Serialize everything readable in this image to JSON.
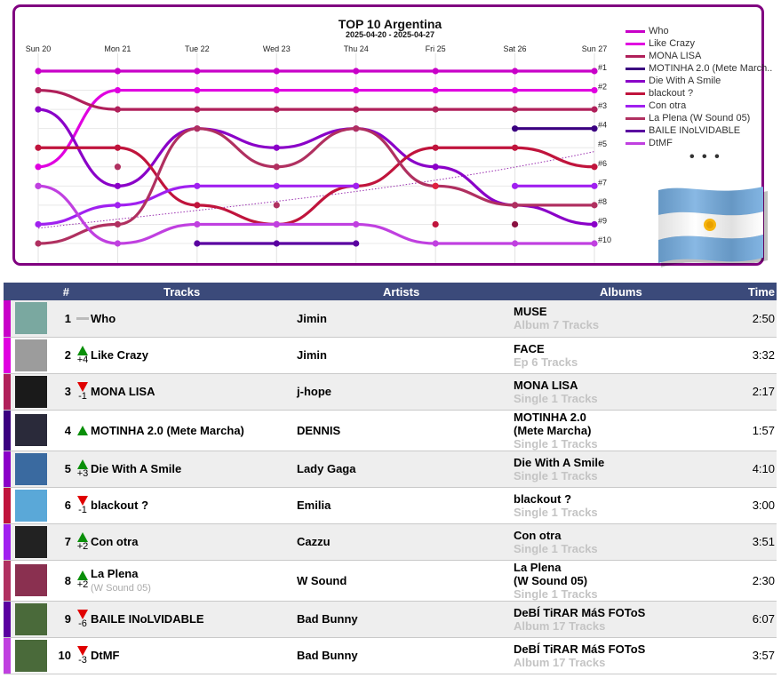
{
  "chart_data": {
    "type": "line",
    "title": "TOP 10 Argentina",
    "subtitle": "2025-04-20 - 2025-04-27",
    "x": [
      "Sun 20",
      "Mon 21",
      "Tue 22",
      "Wed 23",
      "Thu 24",
      "Fri 25",
      "Sat 26",
      "Sun 27"
    ],
    "y_reversed": true,
    "ylim": [
      1,
      10
    ],
    "right_labels": [
      "#1",
      "#2",
      "#3",
      "#4",
      "#5",
      "#6",
      "#7",
      "#8",
      "#9",
      "#10"
    ],
    "grid": true,
    "legend_position": "right",
    "series": [
      {
        "name": "Who",
        "color": "#c800c8",
        "values": [
          1,
          1,
          1,
          1,
          1,
          1,
          1,
          1
        ]
      },
      {
        "name": "Like Crazy",
        "color": "#e000e0",
        "values": [
          6,
          2,
          2,
          2,
          2,
          2,
          2,
          2
        ]
      },
      {
        "name": "MONA LISA",
        "color": "#b0205a",
        "values": [
          2,
          3,
          3,
          3,
          3,
          3,
          3,
          3
        ]
      },
      {
        "name": "MOTINHA 2.0 (Mete March..",
        "color": "#3a0080",
        "values": [
          null,
          null,
          null,
          null,
          null,
          null,
          4,
          4
        ]
      },
      {
        "name": "Die With A Smile",
        "color": "#8a00c8",
        "values": [
          3,
          7,
          4,
          5,
          4,
          6,
          8,
          9
        ]
      },
      {
        "name": "blackout ?",
        "color": "#c0143c",
        "values": [
          5,
          5,
          8,
          9,
          7,
          5,
          5,
          6
        ]
      },
      {
        "name": "Con otra",
        "color": "#a020f0",
        "values": [
          9,
          8,
          7,
          7,
          7,
          null,
          7,
          7
        ]
      },
      {
        "name": "La Plena (W Sound 05)",
        "color": "#b03060",
        "values": [
          10,
          9,
          4,
          6,
          4,
          7,
          8,
          8
        ]
      },
      {
        "name": "BAILE INoLVIDABLE",
        "color": "#5a00a0",
        "values": [
          null,
          null,
          10,
          10,
          10,
          null,
          null,
          null
        ]
      },
      {
        "name": "DtMF",
        "color": "#c040e0",
        "values": [
          7,
          10,
          9,
          9,
          9,
          10,
          10,
          10
        ]
      }
    ],
    "extra_points": [
      {
        "x": "Sun 20",
        "y": 7
      },
      {
        "x": "Mon 21",
        "y": 6
      },
      {
        "x": "Wed 23",
        "y": 8
      },
      {
        "x": "Fri 25",
        "y": 7
      },
      {
        "x": "Fri 25",
        "y": 9
      },
      {
        "x": "Sat 26",
        "y": 9
      }
    ]
  },
  "legend_more": "• • •",
  "table": {
    "headers": {
      "rank": "#",
      "tracks": "Tracks",
      "artists": "Artists",
      "albums": "Albums",
      "time": "Time"
    },
    "rows": [
      {
        "rank": "1",
        "dir": "flat",
        "delta": "",
        "track": "Who",
        "note": "",
        "artist": "Jimin",
        "album": "MUSE",
        "album2": "",
        "meta": "Album 7 Tracks",
        "time": "2:50",
        "bar": "#c800c8",
        "thumb": "#7aa8a0",
        "odd": true
      },
      {
        "rank": "2",
        "dir": "up",
        "delta": "+4",
        "track": "Like Crazy",
        "note": "",
        "artist": "Jimin",
        "album": "FACE",
        "album2": "",
        "meta": "Ep 6 Tracks",
        "time": "3:32",
        "bar": "#e000e0",
        "thumb": "#9c9c9c",
        "odd": false
      },
      {
        "rank": "3",
        "dir": "down",
        "delta": "-1",
        "track": "MONA LISA",
        "note": "",
        "artist": "j-hope",
        "album": "MONA LISA",
        "album2": "",
        "meta": "Single 1 Tracks",
        "time": "2:17",
        "bar": "#b0205a",
        "thumb": "#1a1a1a",
        "odd": true
      },
      {
        "rank": "4",
        "dir": "up",
        "delta": "",
        "track": "MOTINHA 2.0 (Mete Marcha)",
        "note": "",
        "artist": "DENNIS",
        "album": "MOTINHA 2.0",
        "album2": "(Mete Marcha)",
        "meta": "Single 1 Tracks",
        "time": "1:57",
        "bar": "#3a0080",
        "thumb": "#2a2a3a",
        "odd": false
      },
      {
        "rank": "5",
        "dir": "up",
        "delta": "+3",
        "track": "Die With A Smile",
        "note": "",
        "artist": "Lady Gaga",
        "album": "Die With A Smile",
        "album2": "",
        "meta": "Single 1 Tracks",
        "time": "4:10",
        "bar": "#8a00c8",
        "thumb": "#3a6aa0",
        "odd": true
      },
      {
        "rank": "6",
        "dir": "down",
        "delta": "-1",
        "track": "blackout ?",
        "note": "",
        "artist": "Emilia",
        "album": "blackout ?",
        "album2": "",
        "meta": "Single 1 Tracks",
        "time": "3:00",
        "bar": "#c0143c",
        "thumb": "#5aa8d8",
        "odd": false
      },
      {
        "rank": "7",
        "dir": "up",
        "delta": "+2",
        "track": "Con otra",
        "note": "",
        "artist": "Cazzu",
        "album": "Con otra",
        "album2": "",
        "meta": "Single 1 Tracks",
        "time": "3:51",
        "bar": "#a020f0",
        "thumb": "#222222",
        "odd": true
      },
      {
        "rank": "8",
        "dir": "up",
        "delta": "+2",
        "track": "La Plena",
        "note": "(W Sound 05)",
        "artist": "W Sound",
        "album": "La Plena",
        "album2": "(W Sound 05)",
        "meta": "Single 1 Tracks",
        "time": "2:30",
        "bar": "#b03060",
        "thumb": "#8a3050",
        "odd": false
      },
      {
        "rank": "9",
        "dir": "down",
        "delta": "-6",
        "track": "BAILE INoLVIDABLE",
        "note": "",
        "artist": "Bad Bunny",
        "album": "DeBÍ TiRAR MáS FOToS",
        "album2": "",
        "meta": "Album 17 Tracks",
        "time": "6:07",
        "bar": "#5a00a0",
        "thumb": "#4a6a3a",
        "odd": true
      },
      {
        "rank": "10",
        "dir": "down",
        "delta": "-3",
        "track": "DtMF",
        "note": "",
        "artist": "Bad Bunny",
        "album": "DeBÍ TiRAR MáS FOToS",
        "album2": "",
        "meta": "Album 17 Tracks",
        "time": "3:57",
        "bar": "#c040e0",
        "thumb": "#4a6a3a",
        "odd": false
      }
    ]
  }
}
